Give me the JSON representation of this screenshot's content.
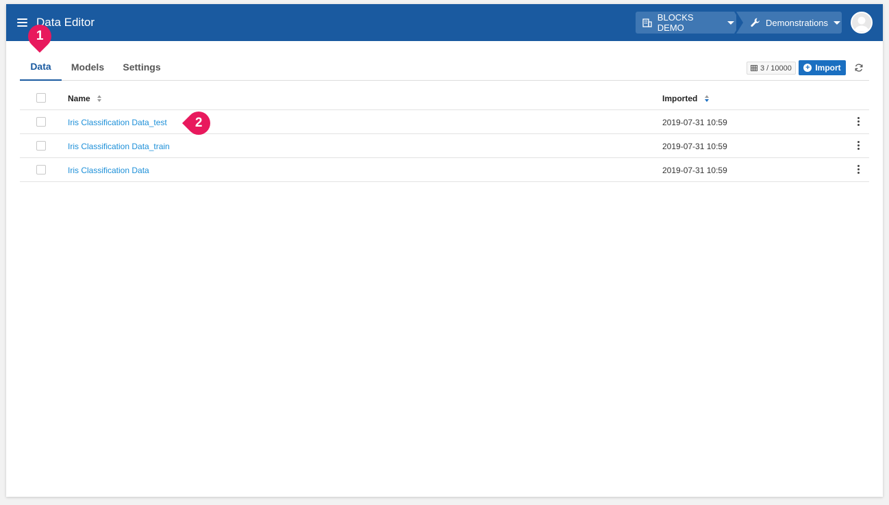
{
  "app": {
    "title": "Data Editor"
  },
  "header": {
    "org_label": "BLOCKS DEMO",
    "project_label": "Demonstrations"
  },
  "tabs": [
    {
      "label": "Data",
      "active": true
    },
    {
      "label": "Models",
      "active": false
    },
    {
      "label": "Settings",
      "active": false
    }
  ],
  "toolbar": {
    "quota_text": "3 / 10000",
    "import_label": "Import"
  },
  "table": {
    "columns": {
      "name": "Name",
      "imported": "Imported"
    },
    "rows": [
      {
        "name": "Iris Classification Data_test",
        "imported": "2019-07-31 10:59"
      },
      {
        "name": "Iris Classification Data_train",
        "imported": "2019-07-31 10:59"
      },
      {
        "name": "Iris Classification Data",
        "imported": "2019-07-31 10:59"
      }
    ]
  },
  "markers": {
    "one": "1",
    "two": "2"
  },
  "colors": {
    "header": "#1a5aa0",
    "accent": "#1a6fc1",
    "link": "#1c8fd8",
    "marker": "#e8195d"
  }
}
